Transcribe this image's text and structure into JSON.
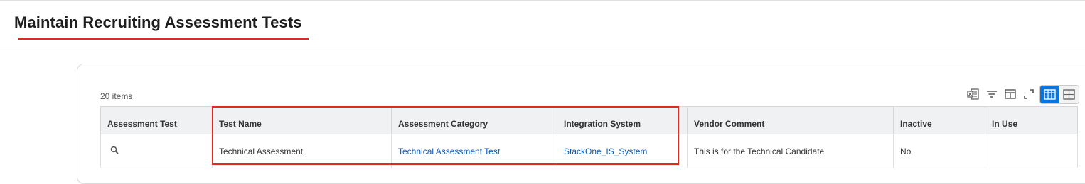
{
  "page": {
    "title": "Maintain Recruiting Assessment Tests"
  },
  "grid": {
    "item_count": "20 items",
    "columns": [
      "Assessment Test",
      "Test Name",
      "Assessment Category",
      "Integration System",
      "Vendor Comment",
      "Inactive",
      "In Use"
    ],
    "rows": [
      {
        "assessment_test": "",
        "test_name": "Technical Assessment",
        "assessment_category": "Technical Assessment Test",
        "integration_system": "StackOne_IS_System",
        "vendor_comment": "This is for the Technical Candidate",
        "inactive": "No",
        "in_use": ""
      }
    ]
  },
  "toolbar": {
    "icons": [
      "export-excel-icon",
      "filter-icon",
      "column-chooser-icon",
      "fullscreen-icon",
      "table-view-icon",
      "grid-view-icon"
    ],
    "active_view": "table-view"
  },
  "colors": {
    "accent": "#0875e1",
    "highlight": "#e6281c",
    "link": "#0b5bb5"
  }
}
